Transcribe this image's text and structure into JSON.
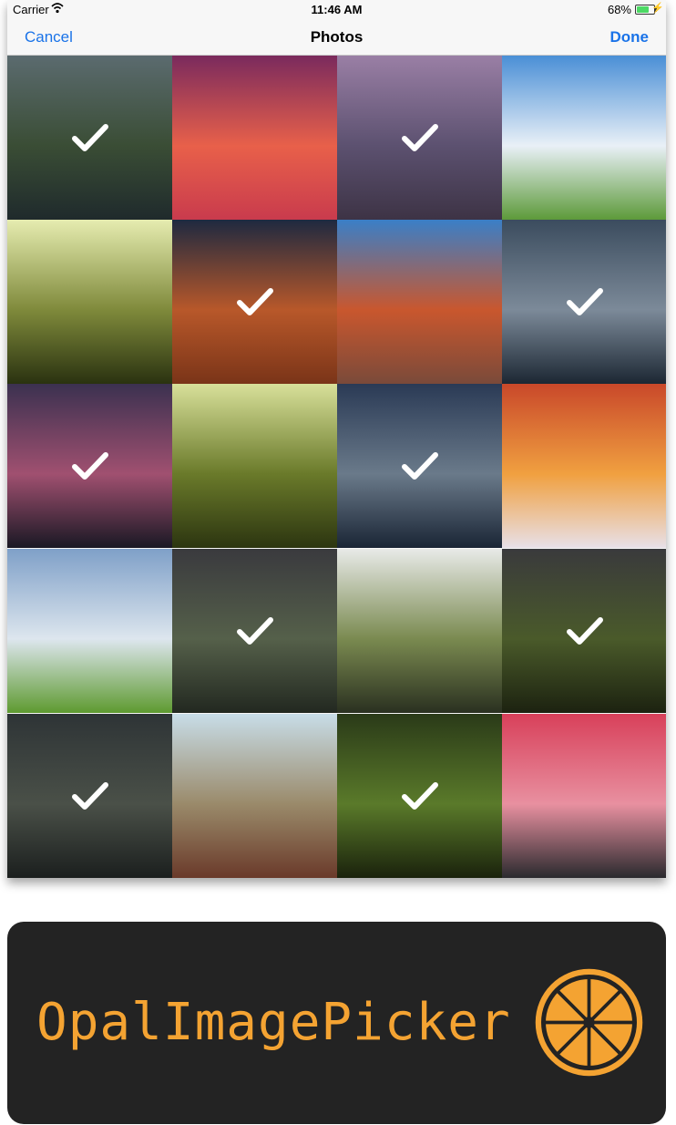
{
  "status_bar": {
    "carrier": "Carrier",
    "time": "11:46 AM",
    "battery": "68%"
  },
  "nav": {
    "cancel": "Cancel",
    "title": "Photos",
    "done": "Done"
  },
  "photos": [
    {
      "name": "waterfall-river",
      "selected": true,
      "colors": [
        "#5b6b6f",
        "#3a4d35",
        "#1f2a2c"
      ]
    },
    {
      "name": "sunset-illustration",
      "selected": false,
      "colors": [
        "#7a2a5d",
        "#e8604a",
        "#c93b4d"
      ]
    },
    {
      "name": "pier-sunset",
      "selected": true,
      "colors": [
        "#9a7fa5",
        "#5c5170",
        "#3d3345"
      ]
    },
    {
      "name": "green-hill-castle",
      "selected": false,
      "colors": [
        "#4a8fd6",
        "#e9f0f7",
        "#5d9a3a"
      ]
    },
    {
      "name": "lone-tree",
      "selected": false,
      "colors": [
        "#e6ecb0",
        "#7f8a3b",
        "#2a3210"
      ]
    },
    {
      "name": "sandstone-wave",
      "selected": true,
      "colors": [
        "#1e2940",
        "#b8582a",
        "#7a3418"
      ]
    },
    {
      "name": "red-rocks-reflection",
      "selected": false,
      "colors": [
        "#3a7fc7",
        "#c9572e",
        "#7a4a3a"
      ]
    },
    {
      "name": "snowy-volcano",
      "selected": true,
      "colors": [
        "#3b4c5e",
        "#7c8a99",
        "#1c2733"
      ]
    },
    {
      "name": "palm-trees-dusk",
      "selected": true,
      "colors": [
        "#3b3150",
        "#a05070",
        "#1a1824"
      ]
    },
    {
      "name": "stone-bridge-forest",
      "selected": false,
      "colors": [
        "#d8e09a",
        "#6a7a2a",
        "#2c3510"
      ]
    },
    {
      "name": "mountain-lake-island",
      "selected": true,
      "colors": [
        "#2a3a55",
        "#6a7a8a",
        "#1a2535"
      ]
    },
    {
      "name": "fiery-sky-snow",
      "selected": false,
      "colors": [
        "#c9482a",
        "#f0a040",
        "#e8e0e8"
      ]
    },
    {
      "name": "country-road",
      "selected": false,
      "colors": [
        "#7fa0c8",
        "#dde6ee",
        "#5e9a30"
      ]
    },
    {
      "name": "misty-waterfall-cliff",
      "selected": true,
      "colors": [
        "#3a3a3e",
        "#55604a",
        "#222820"
      ]
    },
    {
      "name": "cascading-waterfall",
      "selected": false,
      "colors": [
        "#e8eae8",
        "#7a8a50",
        "#2a3020"
      ]
    },
    {
      "name": "waterfall-mossy-cliff",
      "selected": true,
      "colors": [
        "#3a3a3c",
        "#4a5a2a",
        "#1c2210"
      ]
    },
    {
      "name": "dark-rock-spires",
      "selected": true,
      "colors": [
        "#2e3436",
        "#4a5048",
        "#1b1f1e"
      ]
    },
    {
      "name": "yellow-flower-grass",
      "selected": false,
      "colors": [
        "#c8dde8",
        "#9a8a6a",
        "#6a3a2a"
      ]
    },
    {
      "name": "green-leaves",
      "selected": true,
      "colors": [
        "#2a3a18",
        "#5a7a2a",
        "#1a220c"
      ]
    },
    {
      "name": "rocky-lake-sunset",
      "selected": false,
      "colors": [
        "#d8405a",
        "#e890a0",
        "#2a2a2e"
      ]
    }
  ],
  "banner": {
    "name": "OpalImagePicker",
    "background": "#232323",
    "accent": "#f4a332"
  }
}
